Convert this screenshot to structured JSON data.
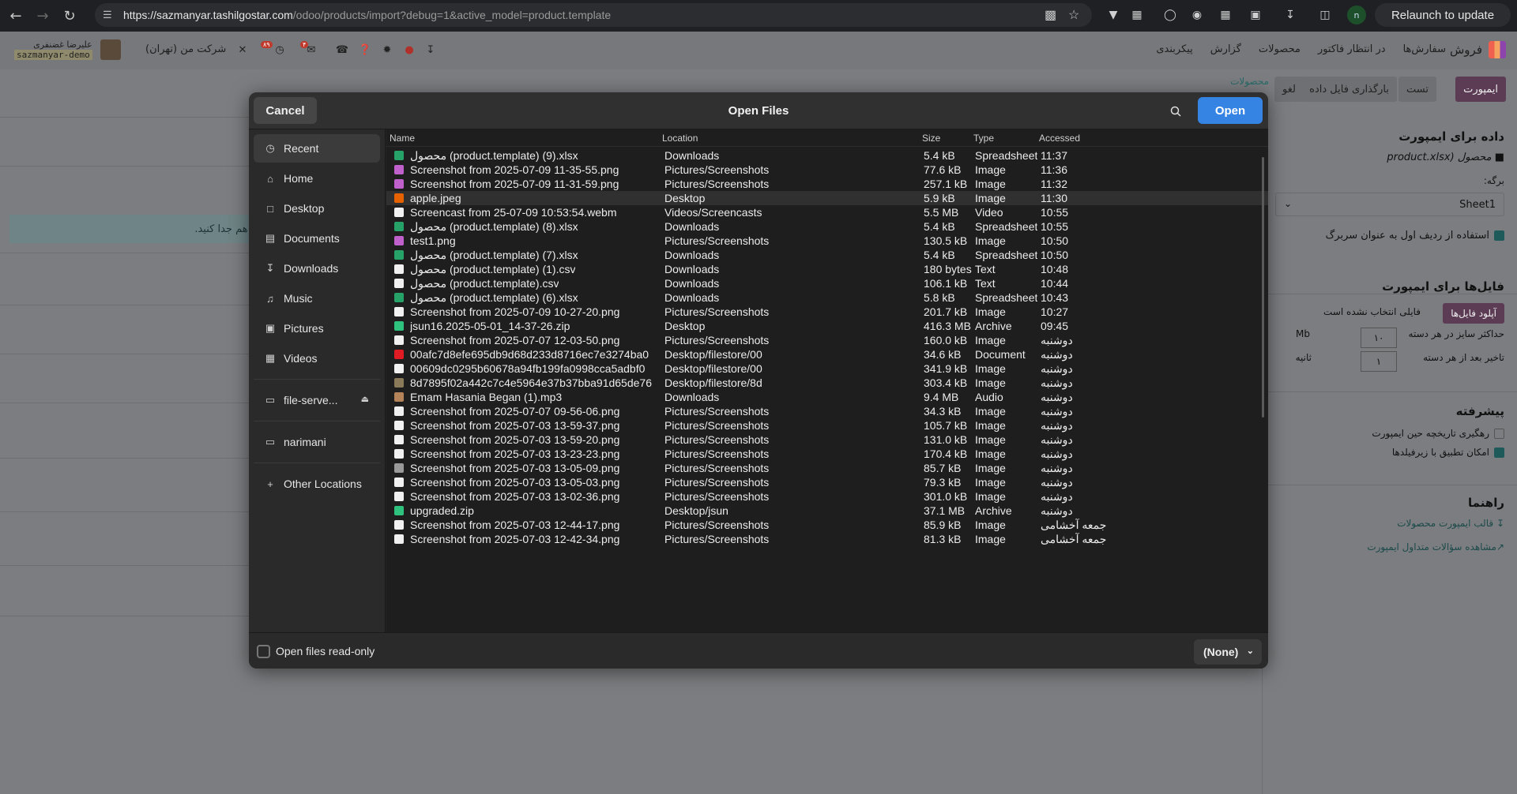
{
  "browser": {
    "url_host": "https://sazmanyar.tashilgostar.com",
    "url_path": "/odoo/products/import?debug=1&active_model=product.template",
    "relaunch_label": "Relaunch to update",
    "profile_initial": "n"
  },
  "odoo": {
    "app_name": "فروش",
    "menu": [
      "سفارش‌ها",
      "در انتظار فاکتور",
      "محصولات",
      "گزارش",
      "پیکربندی"
    ],
    "user_name": "علیرضا غضنفری",
    "db_name": "sazmanyar-demo",
    "company": "شرکت من (تهران)",
    "activity_badge": "۸۹",
    "chat_badge": "۴"
  },
  "control": {
    "import_btn": "ایمپورت",
    "test_btn": "تست",
    "reload_btn": "بارگذاری فایل داده",
    "cancel_btn": "لغو",
    "breadcrumb": "محصولات"
  },
  "page": {
    "banner_text": "ز هم جدا کنید."
  },
  "side_panel": {
    "data_title": "داده برای ایمپورت",
    "file_name": "محصول (product.xlsx",
    "sheet_label": "برگه:",
    "sheet_value": "Sheet1",
    "header_row_label": "استفاده از ردیف اول به عنوان سربرگ",
    "files_title": "فایل‌ها برای ایمپورت",
    "upload_btn": "آپلود فایل‌ها",
    "no_file": "فایلی انتخاب نشده است",
    "batch_size_label": "حداکثر سایز در هر دسته",
    "batch_size_value": "۱۰",
    "batch_size_unit": "Mb",
    "delay_label": "تاخیر بعد از هر دسته",
    "delay_value": "۱",
    "delay_unit": "ثانیه",
    "advanced_title": "پیشرفته",
    "track_label": "رهگیری تاریخچه حین ایمپورت",
    "subfields_label": "امکان تطبیق با زیرفیلدها",
    "help_title": "راهنما",
    "template_link": "قالب ایمپورت محصولات",
    "faq_link": "مشاهده سؤالات متداول ایمپورت"
  },
  "dialog": {
    "title": "Open Files",
    "cancel_label": "Cancel",
    "open_label": "Open",
    "places": [
      {
        "label": "Recent",
        "icon": "clock-icon"
      },
      {
        "label": "Home",
        "icon": "home-icon"
      },
      {
        "label": "Desktop",
        "icon": "desktop-icon"
      },
      {
        "label": "Documents",
        "icon": "documents-icon"
      },
      {
        "label": "Downloads",
        "icon": "download-icon"
      },
      {
        "label": "Music",
        "icon": "music-icon"
      },
      {
        "label": "Pictures",
        "icon": "pictures-icon"
      },
      {
        "label": "Videos",
        "icon": "videos-icon"
      }
    ],
    "bookmarks": [
      {
        "label": "file-serve...",
        "icon": "folder-icon"
      },
      {
        "label": "narimani",
        "icon": "folder-icon"
      }
    ],
    "other_locations": "Other Locations",
    "columns": {
      "name": "Name",
      "location": "Location",
      "size": "Size",
      "type": "Type",
      "accessed": "Accessed"
    },
    "files": [
      {
        "name": "محصول (product.template) (9).xlsx",
        "location": "Downloads",
        "size": "5.4 kB",
        "type": "Spreadsheet",
        "accessed": "11:37",
        "kind": "sheet"
      },
      {
        "name": "Screenshot from 2025-07-09 11-35-55.png",
        "location": "Pictures/Screenshots",
        "size": "77.6 kB",
        "type": "Image",
        "accessed": "11:36",
        "kind": "image"
      },
      {
        "name": "Screenshot from 2025-07-09 11-31-59.png",
        "location": "Pictures/Screenshots",
        "size": "257.1 kB",
        "type": "Image",
        "accessed": "11:32",
        "kind": "image"
      },
      {
        "name": "apple.jpeg",
        "location": "Desktop",
        "size": "5.9 kB",
        "type": "Image",
        "accessed": "11:30",
        "kind": "photo"
      },
      {
        "name": "Screencast from 25-07-09 10:53:54.webm",
        "location": "Videos/Screencasts",
        "size": "5.5 MB",
        "type": "Video",
        "accessed": "10:55",
        "kind": "plain"
      },
      {
        "name": "محصول (product.template) (8).xlsx",
        "location": "Downloads",
        "size": "5.4 kB",
        "type": "Spreadsheet",
        "accessed": "10:55",
        "kind": "sheet"
      },
      {
        "name": "test1.png",
        "location": "Pictures/Screenshots",
        "size": "130.5 kB",
        "type": "Image",
        "accessed": "10:50",
        "kind": "image"
      },
      {
        "name": "محصول (product.template) (7).xlsx",
        "location": "Downloads",
        "size": "5.4 kB",
        "type": "Spreadsheet",
        "accessed": "10:50",
        "kind": "sheet"
      },
      {
        "name": "محصول (product.template) (1).csv",
        "location": "Downloads",
        "size": "180 bytes",
        "type": "Text",
        "accessed": "10:48",
        "kind": "text"
      },
      {
        "name": "محصول (product.template).csv",
        "location": "Downloads",
        "size": "106.1 kB",
        "type": "Text",
        "accessed": "10:44",
        "kind": "text"
      },
      {
        "name": "محصول (product.template) (6).xlsx",
        "location": "Downloads",
        "size": "5.8 kB",
        "type": "Spreadsheet",
        "accessed": "10:43",
        "kind": "sheet"
      },
      {
        "name": "Screenshot from 2025-07-09 10-27-20.png",
        "location": "Pictures/Screenshots",
        "size": "201.7 kB",
        "type": "Image",
        "accessed": "10:27",
        "kind": "plain"
      },
      {
        "name": "jsun16.2025-05-01_14-37-26.zip",
        "location": "Desktop",
        "size": "416.3 MB",
        "type": "Archive",
        "accessed": "09:45",
        "kind": "archive"
      },
      {
        "name": "Screenshot from 2025-07-07 12-03-50.png",
        "location": "Pictures/Screenshots",
        "size": "160.0 kB",
        "type": "Image",
        "accessed": "دوشنبه",
        "kind": "plain"
      },
      {
        "name": "00afc7d8efe695db9d68d233d8716ec7e3274ba0",
        "location": "Desktop/filestore/00",
        "size": "34.6 kB",
        "type": "Document",
        "accessed": "دوشنبه",
        "kind": "pdf"
      },
      {
        "name": "00609dc0295b60678a94fb199fa0998cca5adbf0",
        "location": "Desktop/filestore/00",
        "size": "341.9 kB",
        "type": "Image",
        "accessed": "دوشنبه",
        "kind": "plain"
      },
      {
        "name": "8d7895f02a442c7c4e5964e37b37bba91d65de76",
        "location": "Desktop/filestore/8d",
        "size": "303.4 kB",
        "type": "Image",
        "accessed": "دوشنبه",
        "kind": "photo2"
      },
      {
        "name": "Emam Hasania Began (1).mp3",
        "location": "Downloads",
        "size": "9.4 MB",
        "type": "Audio",
        "accessed": "دوشنبه",
        "kind": "audio"
      },
      {
        "name": "Screenshot from 2025-07-07 09-56-06.png",
        "location": "Pictures/Screenshots",
        "size": "34.3 kB",
        "type": "Image",
        "accessed": "دوشنبه",
        "kind": "plain"
      },
      {
        "name": "Screenshot from 2025-07-03 13-59-37.png",
        "location": "Pictures/Screenshots",
        "size": "105.7 kB",
        "type": "Image",
        "accessed": "دوشنبه",
        "kind": "plain"
      },
      {
        "name": "Screenshot from 2025-07-03 13-59-20.png",
        "location": "Pictures/Screenshots",
        "size": "131.0 kB",
        "type": "Image",
        "accessed": "دوشنبه",
        "kind": "plain"
      },
      {
        "name": "Screenshot from 2025-07-03 13-23-23.png",
        "location": "Pictures/Screenshots",
        "size": "170.4 kB",
        "type": "Image",
        "accessed": "دوشنبه",
        "kind": "plain"
      },
      {
        "name": "Screenshot from 2025-07-03 13-05-09.png",
        "location": "Pictures/Screenshots",
        "size": "85.7 kB",
        "type": "Image",
        "accessed": "دوشنبه",
        "kind": "grey"
      },
      {
        "name": "Screenshot from 2025-07-03 13-05-03.png",
        "location": "Pictures/Screenshots",
        "size": "79.3 kB",
        "type": "Image",
        "accessed": "دوشنبه",
        "kind": "plain"
      },
      {
        "name": "Screenshot from 2025-07-03 13-02-36.png",
        "location": "Pictures/Screenshots",
        "size": "301.0 kB",
        "type": "Image",
        "accessed": "دوشنبه",
        "kind": "plain"
      },
      {
        "name": "upgraded.zip",
        "location": "Desktop/jsun",
        "size": "37.1 MB",
        "type": "Archive",
        "accessed": "دوشنبه",
        "kind": "archive"
      },
      {
        "name": "Screenshot from 2025-07-03 12-44-17.png",
        "location": "Pictures/Screenshots",
        "size": "85.9 kB",
        "type": "Image",
        "accessed": "جمعه آخشامی",
        "kind": "plain"
      },
      {
        "name": "Screenshot from 2025-07-03 12-42-34.png",
        "location": "Pictures/Screenshots",
        "size": "81.3 kB",
        "type": "Image",
        "accessed": "جمعه آخشامی",
        "kind": "plain"
      }
    ],
    "readonly_label": "Open files read-only",
    "filter_label": "(None)"
  },
  "colors": {
    "accent": "#3584e4",
    "odoo_primary": "#5c3c54",
    "sheet_icon": "#26a269",
    "image_icon": "#c061cb",
    "archive_icon": "#2ec27e",
    "pdf_icon": "#e01b24"
  }
}
